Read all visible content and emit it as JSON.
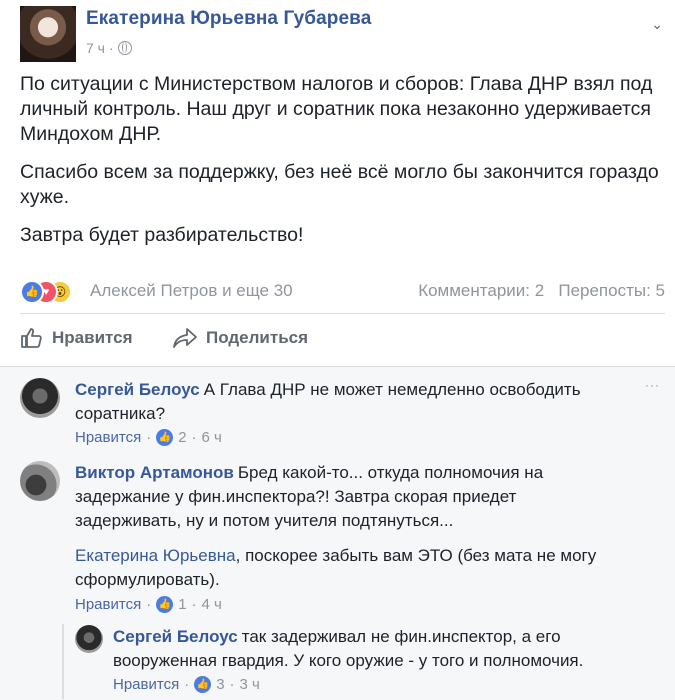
{
  "post": {
    "author": "Екатерина Юрьевна Губарева",
    "time": "7 ч",
    "meta_sep": "·",
    "paragraphs": [
      "По ситуации с Министерством налогов и сборов: Глава ДНР взял под личный контроль. Наш друг и соратник пока незаконно удерживается Миндохом ДНР.",
      "Спасибо всем за поддержку, без неё всё могло бы закончится гораздо хуже.",
      "Завтра будет разбирательство!"
    ],
    "reactions": {
      "icons": [
        "like-reaction",
        "love-reaction",
        "wow-reaction"
      ],
      "names": "Алексей Петров и еще 30"
    },
    "stats": {
      "comments": "Комментарии: 2",
      "shares": "Перепосты: 5"
    }
  },
  "actions": {
    "like": "Нравится",
    "share": "Поделиться"
  },
  "comments": [
    {
      "author": "Сергей Белоус",
      "text": "А Глава ДНР не может немедленно освободить соратника?",
      "like_label": "Нравится",
      "likes": "2",
      "time": "6 ч"
    },
    {
      "author": "Виктор Артамонов",
      "text": "Бред какой-то... откуда полномочия на задержание у фин.инспектора?! Завтра скорая приедет задерживать, ну и потом учителя подтянуться...",
      "text2_mention": "Екатерина Юрьевна",
      "text2": ", поскорее забыть вам ЭТО (без мата не могу сформулировать).",
      "like_label": "Нравится",
      "likes": "1",
      "time": "4 ч"
    }
  ],
  "reply": {
    "author": "Сергей Белоус",
    "text": "так задерживал не фин.инспектор, а его вооруженная гвардия. У кого оружие - у того и полномочия.",
    "like_label": "Нравится",
    "likes": "3",
    "time": "3 ч"
  },
  "ui": {
    "dot": "·",
    "chevron": "⌄",
    "dots": "···",
    "colors": {
      "link": "#365899",
      "muted": "#90949c",
      "like_blue": "#4b7be5",
      "comments_bg": "#f6f7f9"
    }
  }
}
